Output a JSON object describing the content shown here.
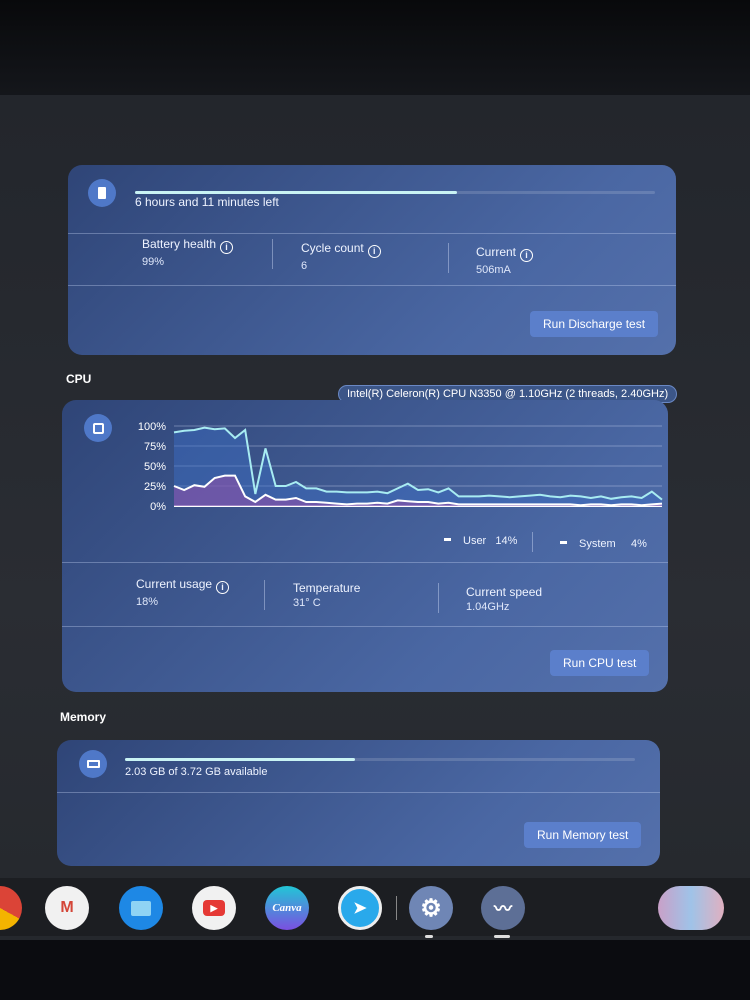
{
  "battery": {
    "time_left": "6 hours and 11 minutes left",
    "charge_percent": 62,
    "stats": [
      {
        "label": "Battery health",
        "value": "99%"
      },
      {
        "label": "Cycle count",
        "value": "6"
      },
      {
        "label": "Current",
        "value": "506mA"
      }
    ],
    "button": "Run Discharge test"
  },
  "cpu": {
    "section_title": "CPU",
    "model": "Intel(R) Celeron(R) CPU N3350 @ 1.10GHz (2 threads, 2.40GHz)",
    "legend": [
      {
        "label": "User",
        "value": "14%"
      },
      {
        "label": "System",
        "value": "4%"
      }
    ],
    "stats": [
      {
        "label": "Current usage",
        "value": "18%"
      },
      {
        "label": "Temperature",
        "value": "31° C"
      },
      {
        "label": "Current speed",
        "value": "1.04GHz"
      }
    ],
    "button": "Run CPU test"
  },
  "memory": {
    "section_title": "Memory",
    "usage_text": "2.03 GB of 3.72 GB available",
    "used_fraction": 0.45,
    "button": "Run Memory test"
  },
  "chart_data": {
    "type": "area",
    "yticks": [
      "100%",
      "75%",
      "50%",
      "25%",
      "0%"
    ],
    "ylim": [
      0,
      100
    ],
    "grid": true,
    "series": [
      {
        "name": "User",
        "color": "#a8ecf2",
        "values": [
          92,
          94,
          95,
          98,
          96,
          97,
          85,
          95,
          15,
          72,
          25,
          25,
          30,
          22,
          22,
          18,
          18,
          17,
          17,
          17,
          18,
          16,
          22,
          28,
          20,
          21,
          17,
          22,
          12,
          12,
          12,
          13,
          12,
          11,
          12,
          13,
          14,
          12,
          11,
          13,
          12,
          10,
          12,
          9,
          11,
          12,
          10,
          18,
          8
        ]
      },
      {
        "name": "System",
        "color": "#ffffff",
        "values": [
          25,
          20,
          26,
          24,
          35,
          38,
          38,
          12,
          5,
          14,
          8,
          8,
          10,
          5,
          5,
          4,
          3,
          2,
          3,
          3,
          4,
          3,
          7,
          6,
          5,
          5,
          3,
          4,
          2,
          2,
          2,
          2,
          2,
          2,
          2,
          2,
          2,
          2,
          2,
          2,
          1,
          2,
          2,
          1,
          2,
          2,
          1,
          2,
          3
        ]
      }
    ]
  },
  "shelf": {
    "apps": [
      {
        "icon": "chrome-icon"
      },
      {
        "icon": "gmail-icon"
      },
      {
        "icon": "files-icon"
      },
      {
        "icon": "youtube-icon"
      },
      {
        "icon": "canva-icon",
        "label": "Canva"
      },
      {
        "icon": "telegram-icon"
      },
      {
        "icon": "settings-icon"
      },
      {
        "icon": "diagnostics-icon"
      }
    ]
  }
}
